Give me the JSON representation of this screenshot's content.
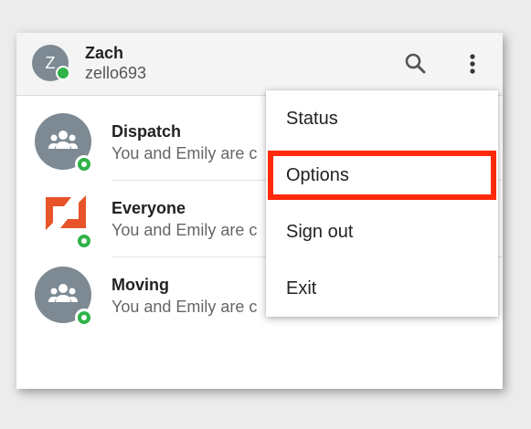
{
  "header": {
    "avatar_letter": "Z",
    "user_name": "Zach",
    "user_id": "zello693"
  },
  "contacts": [
    {
      "name": "Dispatch",
      "subtitle": "You and Emily are c",
      "icon": "group-icon"
    },
    {
      "name": "Everyone",
      "subtitle": "You and Emily are c",
      "icon": "zello-logo-icon"
    },
    {
      "name": "Moving",
      "subtitle": "You and Emily are c",
      "icon": "group-icon"
    }
  ],
  "menu": {
    "items": [
      "Status",
      "Options",
      "Sign out",
      "Exit"
    ],
    "highlighted": "Options"
  },
  "colors": {
    "online": "#2fb34a",
    "avatar": "#7d8a93",
    "highlight_box": "#ff2a0a",
    "logo": "#e8532a"
  }
}
